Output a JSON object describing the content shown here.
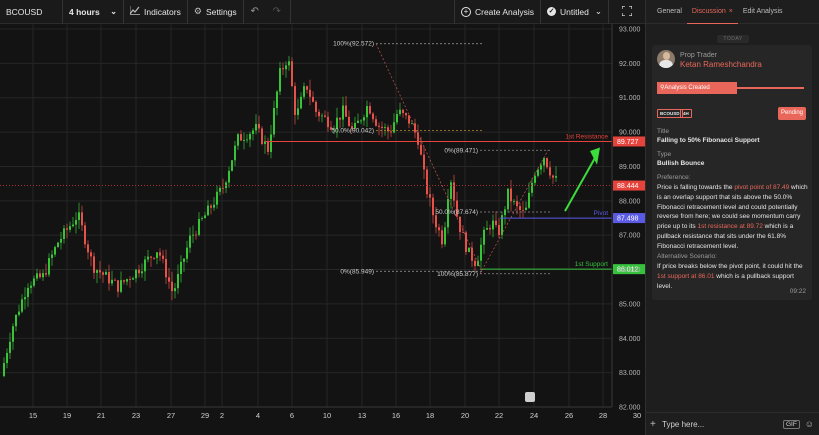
{
  "toolbar": {
    "symbol": "BCOUSD",
    "interval": "4 hours",
    "indicators_label": "Indicators",
    "settings_label": "Settings",
    "create_analysis_label": "Create Analysis",
    "untitled_label": "Untitled"
  },
  "chart": {
    "price_labels": [
      "93.000",
      "92.000",
      "91.000",
      "90.000",
      "89.000",
      "88.000",
      "87.000",
      "86.000",
      "85.000",
      "84.000",
      "83.000",
      "82.000"
    ],
    "date_labels": [
      "15",
      "19",
      "21",
      "23",
      "27",
      "29",
      "2",
      "4",
      "6",
      "10",
      "13",
      "16",
      "18",
      "20",
      "22",
      "24",
      "26",
      "28",
      "30",
      "2"
    ],
    "levels": {
      "resistance": {
        "label": "1st Resistance",
        "price_label": "89.727",
        "color": "#e5433b"
      },
      "current": {
        "price_label": "88.444",
        "color": "#e5433b"
      },
      "pivot": {
        "label": "Pivot",
        "price_label": "87.498",
        "color": "#5a5ae6"
      },
      "support": {
        "label": "1st Support",
        "price_label": "86.012",
        "color": "#36c23c"
      }
    },
    "fib_labels": {
      "f1_100": "100%(92.572)",
      "f1_50": "50.0%(90.042)",
      "f1_0": "0%(85.949)",
      "f2_0": "0%(89.471)",
      "f2_50": "50.0%(87.674)",
      "f2_100": "100%(85.877)"
    }
  },
  "panel": {
    "tabs": [
      "General",
      "Discussion",
      "Edit Analysis"
    ],
    "today": "TODAY",
    "role": "Prop Trader",
    "author": "Ketan Rameshchandra",
    "banner": "Analysis Created",
    "badges": [
      "BCOUSD",
      "4H"
    ],
    "status": "Pending",
    "title_label": "Title",
    "title_value": "Falling to 50% Fibonacci Support",
    "type_label": "Type",
    "type_value": "Bullish Bounce",
    "preference_label": "Preference:",
    "preference": {
      "p1": "Price is falling towards the ",
      "h1": "pivot point of 87.49",
      "p2": " which is an overlap support that sits above the 50.0% Fibonacci retracement level and could potentially reverse from here; we could see momentum carry price up to its ",
      "h2": "1st resistance at 89.72",
      "p3": " which is a pullback resistance that sits under the 61.8% Fibonacci retracement level."
    },
    "alt_label": "Alternative Scenario:",
    "alt": {
      "p1": "If price breaks below the pivot point, it could hit the ",
      "h1": "1st support at 86.01",
      "p2": " which is a pullback support level."
    },
    "time": "09:22",
    "input_placeholder": "Type here...",
    "gif_label": "GIF"
  }
}
